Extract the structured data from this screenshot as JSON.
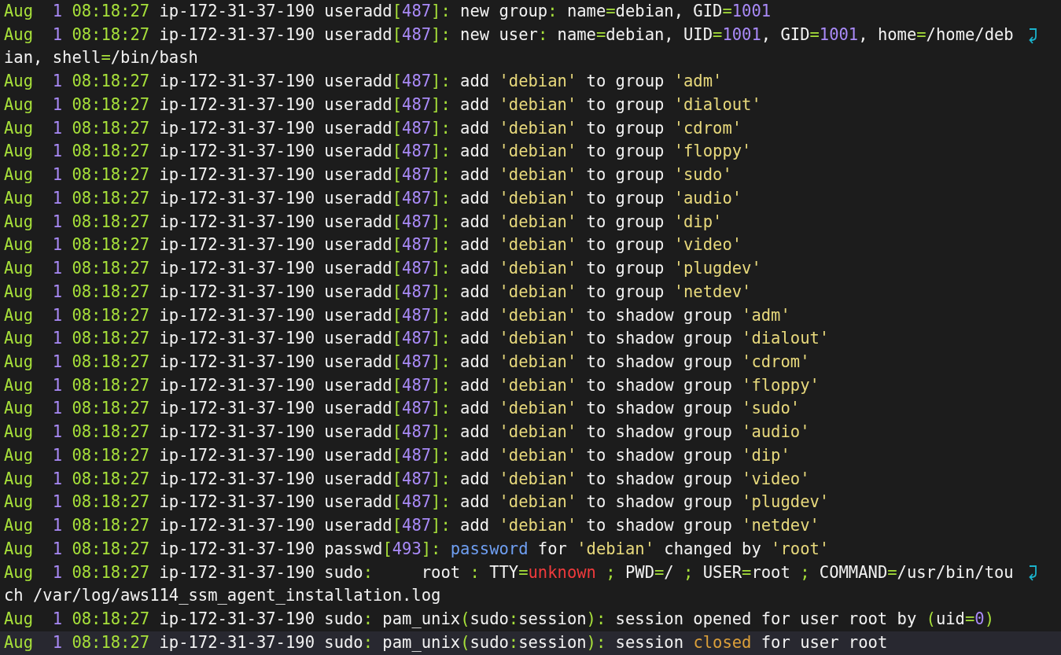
{
  "lines": [
    {
      "selected": false,
      "wrapped": false,
      "segments": [
        {
          "kind": "date",
          "text": "Aug"
        },
        {
          "kind": "number",
          "text": "  1"
        },
        {
          "kind": "date",
          "text": " 08:18:27"
        },
        {
          "kind": "plain",
          "text": " ip-172-31-37-190 useradd"
        },
        {
          "kind": "punct",
          "text": "["
        },
        {
          "kind": "number",
          "text": "487"
        },
        {
          "kind": "punct",
          "text": "]:"
        },
        {
          "kind": "plain",
          "text": " new group"
        },
        {
          "kind": "punct",
          "text": ":"
        },
        {
          "kind": "plain",
          "text": " name"
        },
        {
          "kind": "punct",
          "text": "="
        },
        {
          "kind": "plain",
          "text": "debian, GID"
        },
        {
          "kind": "punct",
          "text": "="
        },
        {
          "kind": "number",
          "text": "1001"
        }
      ]
    },
    {
      "selected": false,
      "wrapped": true,
      "segments": [
        {
          "kind": "date",
          "text": "Aug"
        },
        {
          "kind": "number",
          "text": "  1"
        },
        {
          "kind": "date",
          "text": " 08:18:27"
        },
        {
          "kind": "plain",
          "text": " ip-172-31-37-190 useradd"
        },
        {
          "kind": "punct",
          "text": "["
        },
        {
          "kind": "number",
          "text": "487"
        },
        {
          "kind": "punct",
          "text": "]:"
        },
        {
          "kind": "plain",
          "text": " new user"
        },
        {
          "kind": "punct",
          "text": ":"
        },
        {
          "kind": "plain",
          "text": " name"
        },
        {
          "kind": "punct",
          "text": "="
        },
        {
          "kind": "plain",
          "text": "debian, UID"
        },
        {
          "kind": "punct",
          "text": "="
        },
        {
          "kind": "number",
          "text": "1001"
        },
        {
          "kind": "plain",
          "text": ", GID"
        },
        {
          "kind": "punct",
          "text": "="
        },
        {
          "kind": "number",
          "text": "1001"
        },
        {
          "kind": "plain",
          "text": ", home"
        },
        {
          "kind": "punct",
          "text": "="
        },
        {
          "kind": "plain",
          "text": "/home/deb"
        }
      ]
    },
    {
      "selected": false,
      "wrapped": false,
      "segments": [
        {
          "kind": "plain",
          "text": "ian, shell"
        },
        {
          "kind": "punct",
          "text": "="
        },
        {
          "kind": "plain",
          "text": "/bin/bash"
        }
      ]
    },
    {
      "selected": false,
      "wrapped": false,
      "segments": [
        {
          "kind": "date",
          "text": "Aug"
        },
        {
          "kind": "number",
          "text": "  1"
        },
        {
          "kind": "date",
          "text": " 08:18:27"
        },
        {
          "kind": "plain",
          "text": " ip-172-31-37-190 useradd"
        },
        {
          "kind": "punct",
          "text": "["
        },
        {
          "kind": "number",
          "text": "487"
        },
        {
          "kind": "punct",
          "text": "]:"
        },
        {
          "kind": "plain",
          "text": " add "
        },
        {
          "kind": "string",
          "text": "'debian'"
        },
        {
          "kind": "plain",
          "text": " to group "
        },
        {
          "kind": "string",
          "text": "'adm'"
        }
      ]
    },
    {
      "selected": false,
      "wrapped": false,
      "segments": [
        {
          "kind": "date",
          "text": "Aug"
        },
        {
          "kind": "number",
          "text": "  1"
        },
        {
          "kind": "date",
          "text": " 08:18:27"
        },
        {
          "kind": "plain",
          "text": " ip-172-31-37-190 useradd"
        },
        {
          "kind": "punct",
          "text": "["
        },
        {
          "kind": "number",
          "text": "487"
        },
        {
          "kind": "punct",
          "text": "]:"
        },
        {
          "kind": "plain",
          "text": " add "
        },
        {
          "kind": "string",
          "text": "'debian'"
        },
        {
          "kind": "plain",
          "text": " to group "
        },
        {
          "kind": "string",
          "text": "'dialout'"
        }
      ]
    },
    {
      "selected": false,
      "wrapped": false,
      "segments": [
        {
          "kind": "date",
          "text": "Aug"
        },
        {
          "kind": "number",
          "text": "  1"
        },
        {
          "kind": "date",
          "text": " 08:18:27"
        },
        {
          "kind": "plain",
          "text": " ip-172-31-37-190 useradd"
        },
        {
          "kind": "punct",
          "text": "["
        },
        {
          "kind": "number",
          "text": "487"
        },
        {
          "kind": "punct",
          "text": "]:"
        },
        {
          "kind": "plain",
          "text": " add "
        },
        {
          "kind": "string",
          "text": "'debian'"
        },
        {
          "kind": "plain",
          "text": " to group "
        },
        {
          "kind": "string",
          "text": "'cdrom'"
        }
      ]
    },
    {
      "selected": false,
      "wrapped": false,
      "segments": [
        {
          "kind": "date",
          "text": "Aug"
        },
        {
          "kind": "number",
          "text": "  1"
        },
        {
          "kind": "date",
          "text": " 08:18:27"
        },
        {
          "kind": "plain",
          "text": " ip-172-31-37-190 useradd"
        },
        {
          "kind": "punct",
          "text": "["
        },
        {
          "kind": "number",
          "text": "487"
        },
        {
          "kind": "punct",
          "text": "]:"
        },
        {
          "kind": "plain",
          "text": " add "
        },
        {
          "kind": "string",
          "text": "'debian'"
        },
        {
          "kind": "plain",
          "text": " to group "
        },
        {
          "kind": "string",
          "text": "'floppy'"
        }
      ]
    },
    {
      "selected": false,
      "wrapped": false,
      "segments": [
        {
          "kind": "date",
          "text": "Aug"
        },
        {
          "kind": "number",
          "text": "  1"
        },
        {
          "kind": "date",
          "text": " 08:18:27"
        },
        {
          "kind": "plain",
          "text": " ip-172-31-37-190 useradd"
        },
        {
          "kind": "punct",
          "text": "["
        },
        {
          "kind": "number",
          "text": "487"
        },
        {
          "kind": "punct",
          "text": "]:"
        },
        {
          "kind": "plain",
          "text": " add "
        },
        {
          "kind": "string",
          "text": "'debian'"
        },
        {
          "kind": "plain",
          "text": " to group "
        },
        {
          "kind": "string",
          "text": "'sudo'"
        }
      ]
    },
    {
      "selected": false,
      "wrapped": false,
      "segments": [
        {
          "kind": "date",
          "text": "Aug"
        },
        {
          "kind": "number",
          "text": "  1"
        },
        {
          "kind": "date",
          "text": " 08:18:27"
        },
        {
          "kind": "plain",
          "text": " ip-172-31-37-190 useradd"
        },
        {
          "kind": "punct",
          "text": "["
        },
        {
          "kind": "number",
          "text": "487"
        },
        {
          "kind": "punct",
          "text": "]:"
        },
        {
          "kind": "plain",
          "text": " add "
        },
        {
          "kind": "string",
          "text": "'debian'"
        },
        {
          "kind": "plain",
          "text": " to group "
        },
        {
          "kind": "string",
          "text": "'audio'"
        }
      ]
    },
    {
      "selected": false,
      "wrapped": false,
      "segments": [
        {
          "kind": "date",
          "text": "Aug"
        },
        {
          "kind": "number",
          "text": "  1"
        },
        {
          "kind": "date",
          "text": " 08:18:27"
        },
        {
          "kind": "plain",
          "text": " ip-172-31-37-190 useradd"
        },
        {
          "kind": "punct",
          "text": "["
        },
        {
          "kind": "number",
          "text": "487"
        },
        {
          "kind": "punct",
          "text": "]:"
        },
        {
          "kind": "plain",
          "text": " add "
        },
        {
          "kind": "string",
          "text": "'debian'"
        },
        {
          "kind": "plain",
          "text": " to group "
        },
        {
          "kind": "string",
          "text": "'dip'"
        }
      ]
    },
    {
      "selected": false,
      "wrapped": false,
      "segments": [
        {
          "kind": "date",
          "text": "Aug"
        },
        {
          "kind": "number",
          "text": "  1"
        },
        {
          "kind": "date",
          "text": " 08:18:27"
        },
        {
          "kind": "plain",
          "text": " ip-172-31-37-190 useradd"
        },
        {
          "kind": "punct",
          "text": "["
        },
        {
          "kind": "number",
          "text": "487"
        },
        {
          "kind": "punct",
          "text": "]:"
        },
        {
          "kind": "plain",
          "text": " add "
        },
        {
          "kind": "string",
          "text": "'debian'"
        },
        {
          "kind": "plain",
          "text": " to group "
        },
        {
          "kind": "string",
          "text": "'video'"
        }
      ]
    },
    {
      "selected": false,
      "wrapped": false,
      "segments": [
        {
          "kind": "date",
          "text": "Aug"
        },
        {
          "kind": "number",
          "text": "  1"
        },
        {
          "kind": "date",
          "text": " 08:18:27"
        },
        {
          "kind": "plain",
          "text": " ip-172-31-37-190 useradd"
        },
        {
          "kind": "punct",
          "text": "["
        },
        {
          "kind": "number",
          "text": "487"
        },
        {
          "kind": "punct",
          "text": "]:"
        },
        {
          "kind": "plain",
          "text": " add "
        },
        {
          "kind": "string",
          "text": "'debian'"
        },
        {
          "kind": "plain",
          "text": " to group "
        },
        {
          "kind": "string",
          "text": "'plugdev'"
        }
      ]
    },
    {
      "selected": false,
      "wrapped": false,
      "segments": [
        {
          "kind": "date",
          "text": "Aug"
        },
        {
          "kind": "number",
          "text": "  1"
        },
        {
          "kind": "date",
          "text": " 08:18:27"
        },
        {
          "kind": "plain",
          "text": " ip-172-31-37-190 useradd"
        },
        {
          "kind": "punct",
          "text": "["
        },
        {
          "kind": "number",
          "text": "487"
        },
        {
          "kind": "punct",
          "text": "]:"
        },
        {
          "kind": "plain",
          "text": " add "
        },
        {
          "kind": "string",
          "text": "'debian'"
        },
        {
          "kind": "plain",
          "text": " to group "
        },
        {
          "kind": "string",
          "text": "'netdev'"
        }
      ]
    },
    {
      "selected": false,
      "wrapped": false,
      "segments": [
        {
          "kind": "date",
          "text": "Aug"
        },
        {
          "kind": "number",
          "text": "  1"
        },
        {
          "kind": "date",
          "text": " 08:18:27"
        },
        {
          "kind": "plain",
          "text": " ip-172-31-37-190 useradd"
        },
        {
          "kind": "punct",
          "text": "["
        },
        {
          "kind": "number",
          "text": "487"
        },
        {
          "kind": "punct",
          "text": "]:"
        },
        {
          "kind": "plain",
          "text": " add "
        },
        {
          "kind": "string",
          "text": "'debian'"
        },
        {
          "kind": "plain",
          "text": " to shadow group "
        },
        {
          "kind": "string",
          "text": "'adm'"
        }
      ]
    },
    {
      "selected": false,
      "wrapped": false,
      "segments": [
        {
          "kind": "date",
          "text": "Aug"
        },
        {
          "kind": "number",
          "text": "  1"
        },
        {
          "kind": "date",
          "text": " 08:18:27"
        },
        {
          "kind": "plain",
          "text": " ip-172-31-37-190 useradd"
        },
        {
          "kind": "punct",
          "text": "["
        },
        {
          "kind": "number",
          "text": "487"
        },
        {
          "kind": "punct",
          "text": "]:"
        },
        {
          "kind": "plain",
          "text": " add "
        },
        {
          "kind": "string",
          "text": "'debian'"
        },
        {
          "kind": "plain",
          "text": " to shadow group "
        },
        {
          "kind": "string",
          "text": "'dialout'"
        }
      ]
    },
    {
      "selected": false,
      "wrapped": false,
      "segments": [
        {
          "kind": "date",
          "text": "Aug"
        },
        {
          "kind": "number",
          "text": "  1"
        },
        {
          "kind": "date",
          "text": " 08:18:27"
        },
        {
          "kind": "plain",
          "text": " ip-172-31-37-190 useradd"
        },
        {
          "kind": "punct",
          "text": "["
        },
        {
          "kind": "number",
          "text": "487"
        },
        {
          "kind": "punct",
          "text": "]:"
        },
        {
          "kind": "plain",
          "text": " add "
        },
        {
          "kind": "string",
          "text": "'debian'"
        },
        {
          "kind": "plain",
          "text": " to shadow group "
        },
        {
          "kind": "string",
          "text": "'cdrom'"
        }
      ]
    },
    {
      "selected": false,
      "wrapped": false,
      "segments": [
        {
          "kind": "date",
          "text": "Aug"
        },
        {
          "kind": "number",
          "text": "  1"
        },
        {
          "kind": "date",
          "text": " 08:18:27"
        },
        {
          "kind": "plain",
          "text": " ip-172-31-37-190 useradd"
        },
        {
          "kind": "punct",
          "text": "["
        },
        {
          "kind": "number",
          "text": "487"
        },
        {
          "kind": "punct",
          "text": "]:"
        },
        {
          "kind": "plain",
          "text": " add "
        },
        {
          "kind": "string",
          "text": "'debian'"
        },
        {
          "kind": "plain",
          "text": " to shadow group "
        },
        {
          "kind": "string",
          "text": "'floppy'"
        }
      ]
    },
    {
      "selected": false,
      "wrapped": false,
      "segments": [
        {
          "kind": "date",
          "text": "Aug"
        },
        {
          "kind": "number",
          "text": "  1"
        },
        {
          "kind": "date",
          "text": " 08:18:27"
        },
        {
          "kind": "plain",
          "text": " ip-172-31-37-190 useradd"
        },
        {
          "kind": "punct",
          "text": "["
        },
        {
          "kind": "number",
          "text": "487"
        },
        {
          "kind": "punct",
          "text": "]:"
        },
        {
          "kind": "plain",
          "text": " add "
        },
        {
          "kind": "string",
          "text": "'debian'"
        },
        {
          "kind": "plain",
          "text": " to shadow group "
        },
        {
          "kind": "string",
          "text": "'sudo'"
        }
      ]
    },
    {
      "selected": false,
      "wrapped": false,
      "segments": [
        {
          "kind": "date",
          "text": "Aug"
        },
        {
          "kind": "number",
          "text": "  1"
        },
        {
          "kind": "date",
          "text": " 08:18:27"
        },
        {
          "kind": "plain",
          "text": " ip-172-31-37-190 useradd"
        },
        {
          "kind": "punct",
          "text": "["
        },
        {
          "kind": "number",
          "text": "487"
        },
        {
          "kind": "punct",
          "text": "]:"
        },
        {
          "kind": "plain",
          "text": " add "
        },
        {
          "kind": "string",
          "text": "'debian'"
        },
        {
          "kind": "plain",
          "text": " to shadow group "
        },
        {
          "kind": "string",
          "text": "'audio'"
        }
      ]
    },
    {
      "selected": false,
      "wrapped": false,
      "segments": [
        {
          "kind": "date",
          "text": "Aug"
        },
        {
          "kind": "number",
          "text": "  1"
        },
        {
          "kind": "date",
          "text": " 08:18:27"
        },
        {
          "kind": "plain",
          "text": " ip-172-31-37-190 useradd"
        },
        {
          "kind": "punct",
          "text": "["
        },
        {
          "kind": "number",
          "text": "487"
        },
        {
          "kind": "punct",
          "text": "]:"
        },
        {
          "kind": "plain",
          "text": " add "
        },
        {
          "kind": "string",
          "text": "'debian'"
        },
        {
          "kind": "plain",
          "text": " to shadow group "
        },
        {
          "kind": "string",
          "text": "'dip'"
        }
      ]
    },
    {
      "selected": false,
      "wrapped": false,
      "segments": [
        {
          "kind": "date",
          "text": "Aug"
        },
        {
          "kind": "number",
          "text": "  1"
        },
        {
          "kind": "date",
          "text": " 08:18:27"
        },
        {
          "kind": "plain",
          "text": " ip-172-31-37-190 useradd"
        },
        {
          "kind": "punct",
          "text": "["
        },
        {
          "kind": "number",
          "text": "487"
        },
        {
          "kind": "punct",
          "text": "]:"
        },
        {
          "kind": "plain",
          "text": " add "
        },
        {
          "kind": "string",
          "text": "'debian'"
        },
        {
          "kind": "plain",
          "text": " to shadow group "
        },
        {
          "kind": "string",
          "text": "'video'"
        }
      ]
    },
    {
      "selected": false,
      "wrapped": false,
      "segments": [
        {
          "kind": "date",
          "text": "Aug"
        },
        {
          "kind": "number",
          "text": "  1"
        },
        {
          "kind": "date",
          "text": " 08:18:27"
        },
        {
          "kind": "plain",
          "text": " ip-172-31-37-190 useradd"
        },
        {
          "kind": "punct",
          "text": "["
        },
        {
          "kind": "number",
          "text": "487"
        },
        {
          "kind": "punct",
          "text": "]:"
        },
        {
          "kind": "plain",
          "text": " add "
        },
        {
          "kind": "string",
          "text": "'debian'"
        },
        {
          "kind": "plain",
          "text": " to shadow group "
        },
        {
          "kind": "string",
          "text": "'plugdev'"
        }
      ]
    },
    {
      "selected": false,
      "wrapped": false,
      "segments": [
        {
          "kind": "date",
          "text": "Aug"
        },
        {
          "kind": "number",
          "text": "  1"
        },
        {
          "kind": "date",
          "text": " 08:18:27"
        },
        {
          "kind": "plain",
          "text": " ip-172-31-37-190 useradd"
        },
        {
          "kind": "punct",
          "text": "["
        },
        {
          "kind": "number",
          "text": "487"
        },
        {
          "kind": "punct",
          "text": "]:"
        },
        {
          "kind": "plain",
          "text": " add "
        },
        {
          "kind": "string",
          "text": "'debian'"
        },
        {
          "kind": "plain",
          "text": " to shadow group "
        },
        {
          "kind": "string",
          "text": "'netdev'"
        }
      ]
    },
    {
      "selected": false,
      "wrapped": false,
      "segments": [
        {
          "kind": "date",
          "text": "Aug"
        },
        {
          "kind": "number",
          "text": "  1"
        },
        {
          "kind": "date",
          "text": " 08:18:27"
        },
        {
          "kind": "plain",
          "text": " ip-172-31-37-190 passwd"
        },
        {
          "kind": "punct",
          "text": "["
        },
        {
          "kind": "number",
          "text": "493"
        },
        {
          "kind": "punct",
          "text": "]:"
        },
        {
          "kind": "keyword",
          "text": " password"
        },
        {
          "kind": "plain",
          "text": " for "
        },
        {
          "kind": "string",
          "text": "'debian'"
        },
        {
          "kind": "plain",
          "text": " changed by "
        },
        {
          "kind": "string",
          "text": "'root'"
        }
      ]
    },
    {
      "selected": false,
      "wrapped": true,
      "segments": [
        {
          "kind": "date",
          "text": "Aug"
        },
        {
          "kind": "number",
          "text": "  1"
        },
        {
          "kind": "date",
          "text": " 08:18:27"
        },
        {
          "kind": "plain",
          "text": " ip-172-31-37-190 sudo"
        },
        {
          "kind": "punct",
          "text": ":"
        },
        {
          "kind": "plain",
          "text": "     root "
        },
        {
          "kind": "punct",
          "text": ":"
        },
        {
          "kind": "plain",
          "text": " TTY"
        },
        {
          "kind": "punct",
          "text": "="
        },
        {
          "kind": "error",
          "text": "unknown"
        },
        {
          "kind": "punct",
          "text": " ;"
        },
        {
          "kind": "plain",
          "text": " PWD"
        },
        {
          "kind": "punct",
          "text": "="
        },
        {
          "kind": "plain",
          "text": "/ "
        },
        {
          "kind": "punct",
          "text": ";"
        },
        {
          "kind": "plain",
          "text": " USER"
        },
        {
          "kind": "punct",
          "text": "="
        },
        {
          "kind": "plain",
          "text": "root "
        },
        {
          "kind": "punct",
          "text": ";"
        },
        {
          "kind": "plain",
          "text": " COMMAND"
        },
        {
          "kind": "punct",
          "text": "="
        },
        {
          "kind": "plain",
          "text": "/usr/bin/tou"
        }
      ]
    },
    {
      "selected": false,
      "wrapped": false,
      "segments": [
        {
          "kind": "plain",
          "text": "ch /var/log/aws114_ssm_agent_installation.log"
        }
      ]
    },
    {
      "selected": false,
      "wrapped": false,
      "segments": [
        {
          "kind": "date",
          "text": "Aug"
        },
        {
          "kind": "number",
          "text": "  1"
        },
        {
          "kind": "date",
          "text": " 08:18:27"
        },
        {
          "kind": "plain",
          "text": " ip-172-31-37-190 sudo"
        },
        {
          "kind": "punct",
          "text": ":"
        },
        {
          "kind": "plain",
          "text": " pam_unix"
        },
        {
          "kind": "punct",
          "text": "("
        },
        {
          "kind": "plain",
          "text": "sudo"
        },
        {
          "kind": "punct",
          "text": ":"
        },
        {
          "kind": "plain",
          "text": "session"
        },
        {
          "kind": "punct",
          "text": "):"
        },
        {
          "kind": "plain",
          "text": " session opened for user root by "
        },
        {
          "kind": "punct",
          "text": "("
        },
        {
          "kind": "plain",
          "text": "uid"
        },
        {
          "kind": "punct",
          "text": "="
        },
        {
          "kind": "number",
          "text": "0"
        },
        {
          "kind": "punct",
          "text": ")"
        }
      ]
    },
    {
      "selected": true,
      "wrapped": false,
      "segments": [
        {
          "kind": "date",
          "text": "Aug"
        },
        {
          "kind": "number",
          "text": "  1"
        },
        {
          "kind": "date",
          "text": " 08:18:27"
        },
        {
          "kind": "plain",
          "text": " ip-172-31-37-190 sudo"
        },
        {
          "kind": "punct",
          "text": ":"
        },
        {
          "kind": "plain",
          "text": " pam_unix"
        },
        {
          "kind": "punct",
          "text": "("
        },
        {
          "kind": "plain",
          "text": "sudo"
        },
        {
          "kind": "punct",
          "text": ":"
        },
        {
          "kind": "plain",
          "text": "session"
        },
        {
          "kind": "punct",
          "text": "):"
        },
        {
          "kind": "plain",
          "text": " session "
        },
        {
          "kind": "warning",
          "text": "closed"
        },
        {
          "kind": "plain",
          "text": " for user root"
        }
      ]
    }
  ]
}
